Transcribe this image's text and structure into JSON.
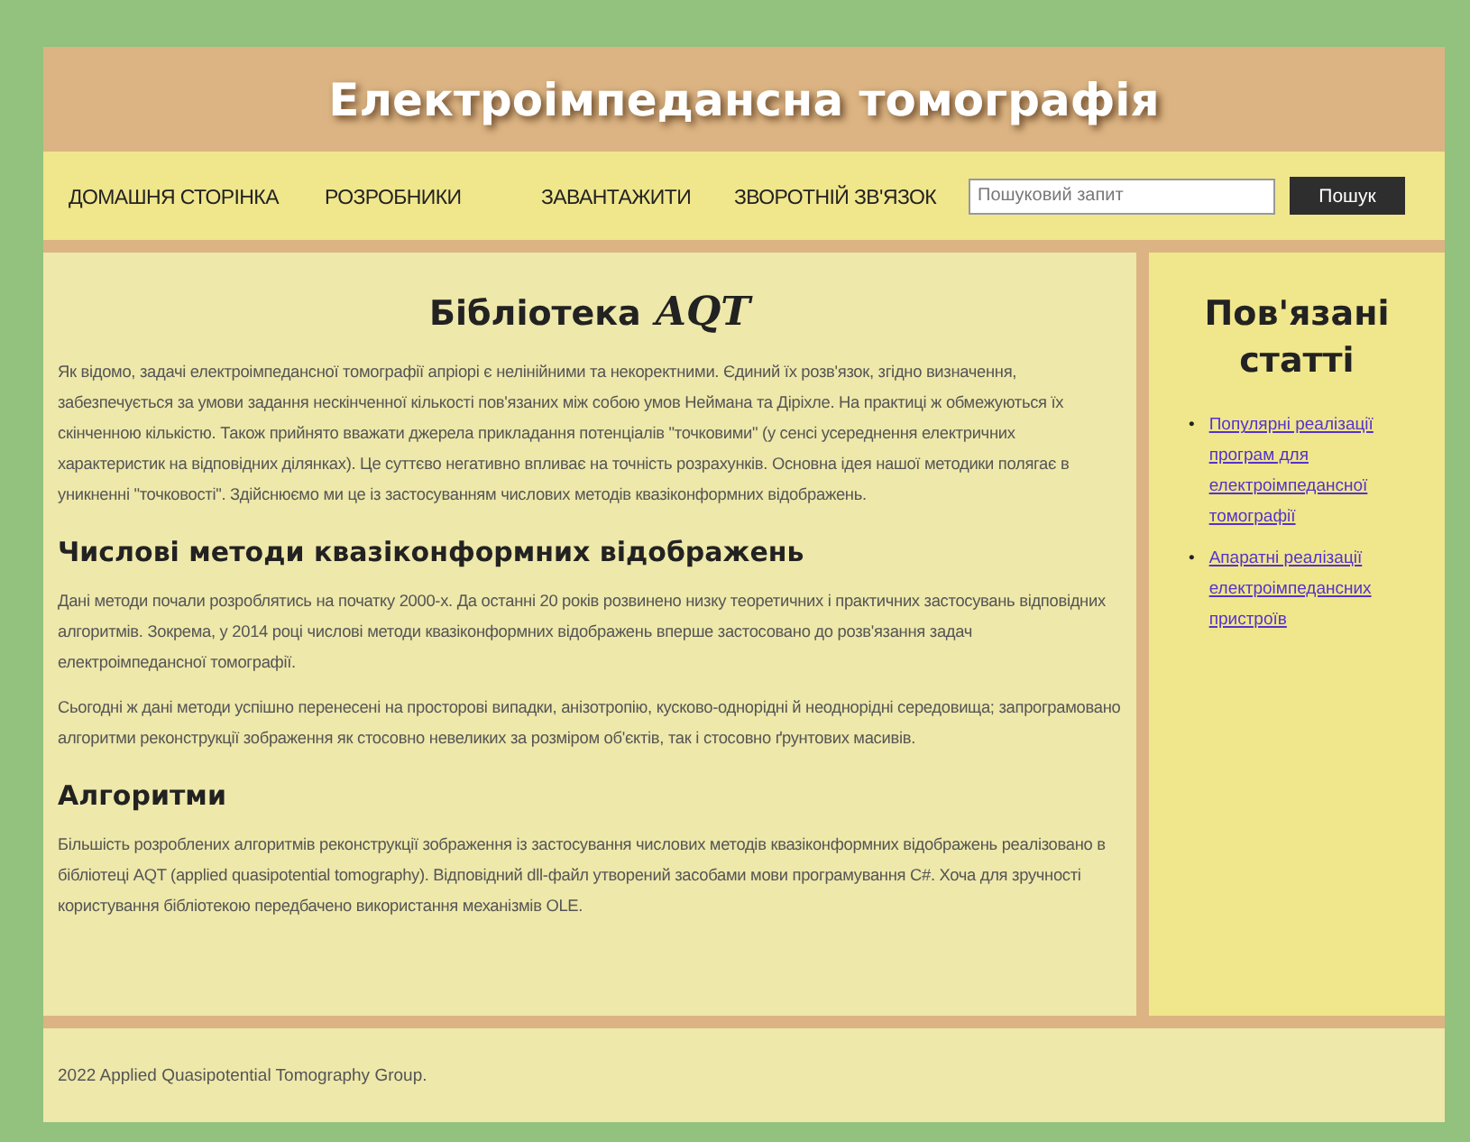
{
  "header": {
    "title": "Електроімпедансна томографія"
  },
  "nav": {
    "items": [
      {
        "label": "ДОМАШНЯ СТОРІНКА"
      },
      {
        "label": "РОЗРОБНИКИ"
      },
      {
        "label": "ЗАВАНТАЖИТИ"
      },
      {
        "label": "ЗВОРОТНІЙ ЗВ'ЯЗОК"
      }
    ],
    "search": {
      "placeholder": "Пошуковий запит",
      "button": "Пошук"
    }
  },
  "main": {
    "title": "Бібліотека",
    "title_logo": "AQT",
    "intro": "Як відомо, задачі електроімпедансної томографії апріорі є нелінійними та некоректними. Єдиний їх розв'язок, згідно визначення, забезпечується за умови задання нескінченної кількості пов'язаних між собою умов Неймана та Діріхле. На практиці ж обмежуються їх скінченною кількістю. Також прийнято вважати джерела прикладання потенціалів \"точковими\" (у сенсі усереднення електричних характеристик на відповідних ділянках). Це суттєво негативно впливає на точність розрахунків. Основна ідея нашої методики полягає в уникненні \"точковості\". Здійснюємо ми це із застосуванням числових методів квазіконформних відображень.",
    "sections": [
      {
        "heading": "Числові методи квазіконформних відображень",
        "paragraphs": [
          "Дані методи почали розроблятись на початку 2000-х. Да останні 20 років розвинено низку теоретичних і практичних застосувань відповідних алгоритмів. Зокрема, у 2014 році числові методи квазіконформних відображень вперше застосовано до розв'язання задач електроімпедансної томографії.",
          "Сьогодні ж дані методи успішно перенесені на просторові випадки, анізотропію, кусково-однорідні й неоднорідні середовища; запрограмовано алгоритми реконструкції зображення як стосовно невеликих за розміром об'єктів, так і стосовно ґрунтових масивів."
        ]
      },
      {
        "heading": "Алгоритми",
        "paragraphs": [
          "Більшість розроблених алгоритмів реконструкції зображення із застосування числових методів квазіконформних відображень реалізовано в бібліотеці AQT (applied quasipotential tomography). Відповідний dll-файл утворений засобами мови програмування C#. Хоча для зручності користування бібліотекою передбачено використання механізмів OLE."
        ]
      }
    ]
  },
  "sidebar": {
    "title": "Пов'язані статті",
    "links": [
      {
        "marker": "•",
        "label": "Популярні реалізації програм для електроімпедансної томографії"
      },
      {
        "marker": "•",
        "label": "Апаратні реалізації електроімпедансних пристроїв"
      }
    ]
  },
  "footer": {
    "text": "2022 Applied Quasipotential Tomography Group."
  }
}
